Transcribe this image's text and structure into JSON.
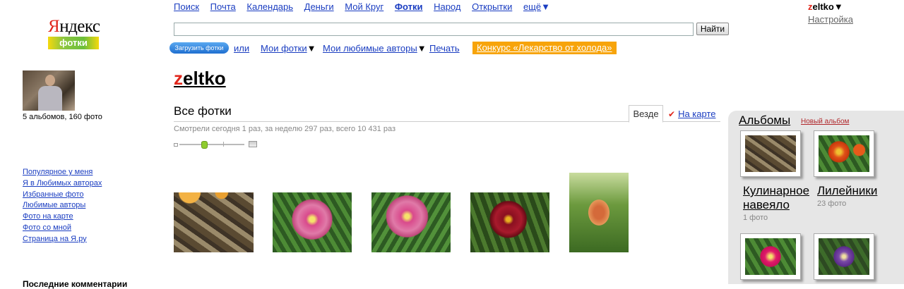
{
  "logo": {
    "yandex": "Яндекс",
    "yandex_first_letter": "Я",
    "yandex_rest": "ндекс",
    "service": "фотки"
  },
  "topnav": {
    "items": [
      "Поиск",
      "Почта",
      "Календарь",
      "Деньги",
      "Мой Круг",
      "Фотки",
      "Народ",
      "Открытки"
    ],
    "active": "Фотки",
    "more": "ещё"
  },
  "search": {
    "value": "",
    "button": "Найти"
  },
  "user": {
    "name": "zeltko",
    "name_first": "z",
    "name_rest": "eltko",
    "settings": "Настройка"
  },
  "subnav": {
    "upload": "Загрузить фотки",
    "or": "или",
    "my_photos": "Мои фотки",
    "fav_authors": "Мои любимые авторы",
    "print": "Печать",
    "contest": "Конкурс «Лекарство от холода»"
  },
  "profile": {
    "stats": "5 альбомов, 160 фото",
    "links": [
      "Популярное у меня",
      "Я в Любимых авторах",
      "Избранные фото",
      "Любимые авторы",
      "Фото на карте",
      "Фото со мной",
      "Страница на Я.ру"
    ],
    "last_comments": "Последние комментарии"
  },
  "main": {
    "owner_first": "z",
    "owner_rest": "eltko",
    "title": "Все фотки",
    "tab_all": "Везде",
    "tab_map": "На карте",
    "views": "Смотрели сегодня 1 раз, за неделю 297 раз, всего 10 431 раз",
    "thumb_size_level": 0.4
  },
  "albums": {
    "title": "Альбомы",
    "new_album": "Новый альбом",
    "items": [
      {
        "name_line1": "Кулинарное",
        "name_line2": "навеяло",
        "count": "1 фото"
      },
      {
        "name_line1": "Лилейники",
        "name_line2": "",
        "count": "23 фото"
      }
    ]
  }
}
